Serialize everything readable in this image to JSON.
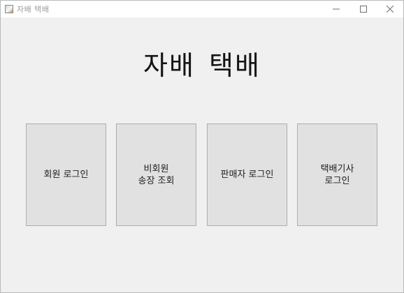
{
  "window": {
    "title": "자배 택배",
    "app_icon": "java-cup-icon",
    "controls": {
      "minimize": "minimize-icon",
      "maximize": "maximize-icon",
      "close": "close-icon"
    }
  },
  "main": {
    "heading": "자배  택배",
    "buttons": [
      {
        "label": "회원  로그인"
      },
      {
        "label": "비회원\n송장 조회"
      },
      {
        "label": "판매자 로그인"
      },
      {
        "label": "택배기사\n로그인"
      }
    ]
  }
}
